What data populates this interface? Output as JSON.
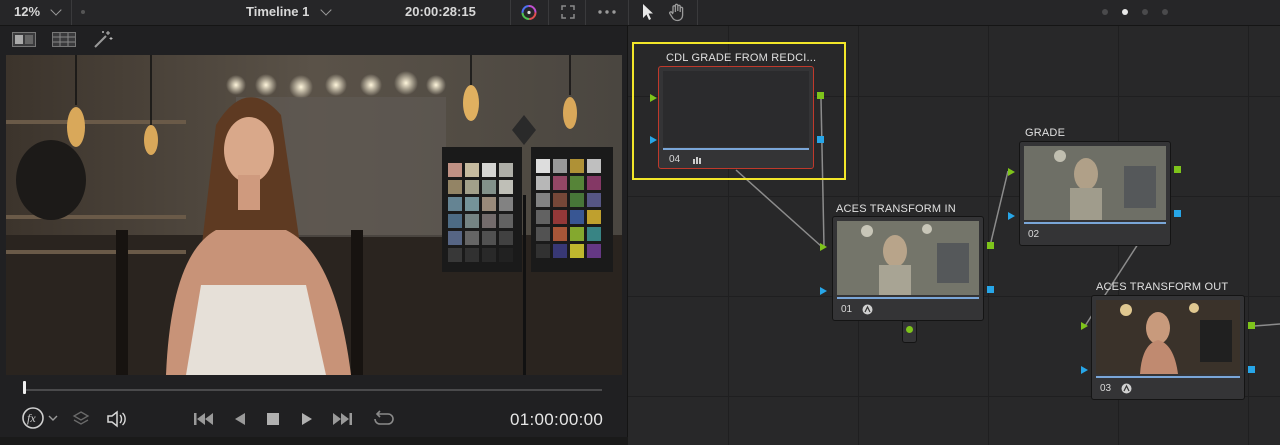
{
  "topbar": {
    "zoom": "12%",
    "timeline_name": "Timeline 1",
    "source_timecode": "20:00:28:15"
  },
  "viewer": {
    "timecode": "01:00:00:00"
  },
  "nodes": [
    {
      "id": "04",
      "label": "CDL GRADE FROM REDCI..."
    },
    {
      "id": "01",
      "label": "ACES TRANSFORM IN"
    },
    {
      "id": "02",
      "label": "GRADE"
    },
    {
      "id": "03",
      "label": "ACES TRANSFORM OUT"
    }
  ],
  "colors": {
    "selection_highlight": "#f2e629",
    "selected_node_border": "#c0392b",
    "input_pin": "#7ec41b",
    "key_pin": "#27a6e8",
    "playhead": "#f0f0f0"
  },
  "icons": {
    "fx": "fx-icon",
    "layers": "layers-icon",
    "speaker": "speaker-icon",
    "prev": "skip-back-icon",
    "back": "play-reverse-icon",
    "stop": "stop-icon",
    "play": "play-icon",
    "next": "skip-forward-icon",
    "loop": "loop-icon",
    "pointer": "pointer-icon",
    "hand": "hand-icon",
    "more": "more-icon"
  }
}
